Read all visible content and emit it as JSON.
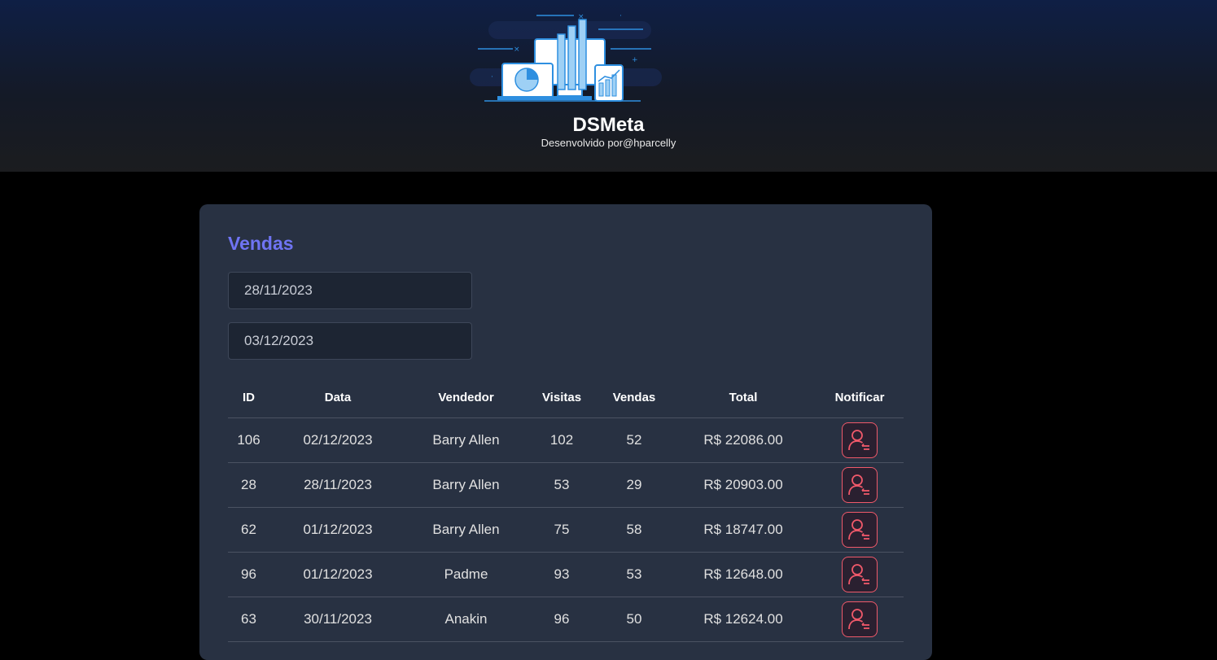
{
  "header": {
    "title": "DSMeta",
    "subtitle": "Desenvolvido por@hparcelly",
    "logo_icon": "dashboard-devices-illustration"
  },
  "colors": {
    "accent": "#6f74f3",
    "notify": "#f0596a",
    "card": "#283142",
    "input_bg": "#1d2533"
  },
  "sales": {
    "title": "Vendas",
    "min_date": "28/11/2023",
    "max_date": "03/12/2023",
    "columns": [
      "ID",
      "Data",
      "Vendedor",
      "Visitas",
      "Vendas",
      "Total",
      "Notificar"
    ],
    "notify_icon": "user-notify-icon",
    "rows": [
      {
        "id": "106",
        "date": "02/12/2023",
        "seller": "Barry Allen",
        "visits": "102",
        "deals": "52",
        "total": "R$ 22086.00"
      },
      {
        "id": "28",
        "date": "28/11/2023",
        "seller": "Barry Allen",
        "visits": "53",
        "deals": "29",
        "total": "R$ 20903.00"
      },
      {
        "id": "62",
        "date": "01/12/2023",
        "seller": "Barry Allen",
        "visits": "75",
        "deals": "58",
        "total": "R$ 18747.00"
      },
      {
        "id": "96",
        "date": "01/12/2023",
        "seller": "Padme",
        "visits": "93",
        "deals": "53",
        "total": "R$ 12648.00"
      },
      {
        "id": "63",
        "date": "30/11/2023",
        "seller": "Anakin",
        "visits": "96",
        "deals": "50",
        "total": "R$ 12624.00"
      }
    ]
  }
}
